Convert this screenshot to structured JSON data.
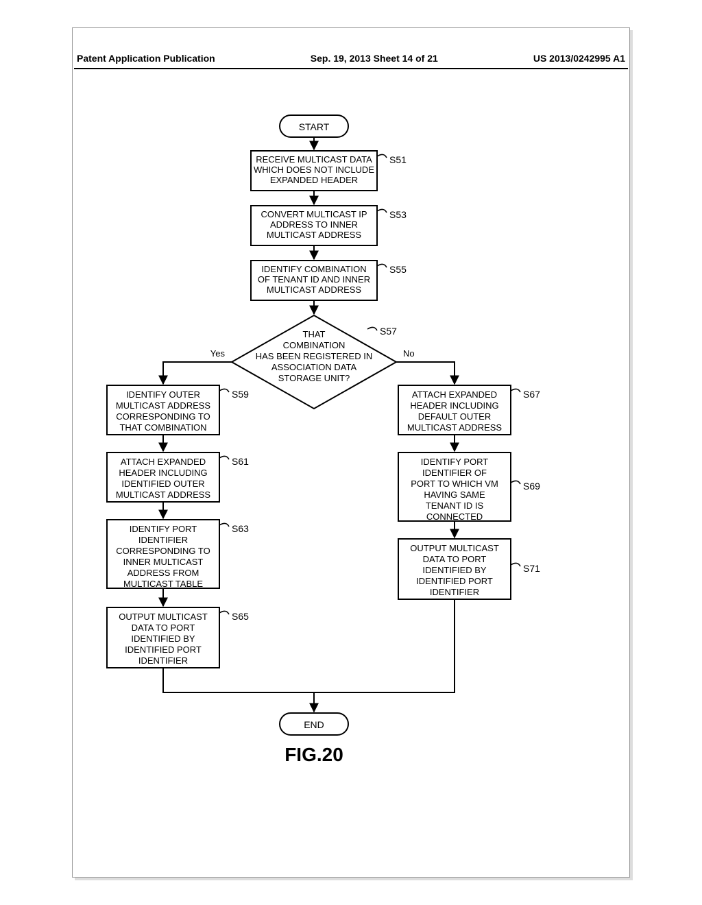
{
  "header": {
    "left": "Patent Application Publication",
    "center": "Sep. 19, 2013  Sheet 14 of 21",
    "right": "US 2013/0242995 A1"
  },
  "terminals": {
    "start": "START",
    "end": "END"
  },
  "edges": {
    "yes": "Yes",
    "no": "No"
  },
  "steps": {
    "s51": {
      "label": "S51",
      "lines": [
        "RECEIVE MULTICAST DATA",
        "WHICH DOES NOT INCLUDE",
        "EXPANDED HEADER"
      ]
    },
    "s53": {
      "label": "S53",
      "lines": [
        "CONVERT MULTICAST IP",
        "ADDRESS TO INNER",
        "MULTICAST ADDRESS"
      ]
    },
    "s55": {
      "label": "S55",
      "lines": [
        "IDENTIFY COMBINATION",
        "OF TENANT ID AND INNER",
        "MULTICAST ADDRESS"
      ]
    },
    "s57": {
      "label": "S57",
      "lines": [
        "THAT",
        "COMBINATION",
        "HAS BEEN REGISTERED IN",
        "ASSOCIATION DATA",
        "STORAGE UNIT?"
      ]
    },
    "s59": {
      "label": "S59",
      "lines": [
        "IDENTIFY OUTER",
        "MULTICAST ADDRESS",
        "CORRESPONDING TO",
        "THAT COMBINATION"
      ]
    },
    "s61": {
      "label": "S61",
      "lines": [
        "ATTACH EXPANDED",
        "HEADER INCLUDING",
        "IDENTIFIED OUTER",
        "MULTICAST ADDRESS"
      ]
    },
    "s63": {
      "label": "S63",
      "lines": [
        "IDENTIFY PORT",
        "IDENTIFIER",
        "CORRESPONDING TO",
        "INNER MULTICAST",
        "ADDRESS FROM",
        "MULTICAST TABLE"
      ]
    },
    "s65": {
      "label": "S65",
      "lines": [
        "OUTPUT MULTICAST",
        "DATA TO PORT",
        "IDENTIFIED BY",
        "IDENTIFIED PORT",
        "IDENTIFIER"
      ]
    },
    "s67": {
      "label": "S67",
      "lines": [
        "ATTACH EXPANDED",
        "HEADER INCLUDING",
        "DEFAULT OUTER",
        "MULTICAST ADDRESS"
      ]
    },
    "s69": {
      "label": "S69",
      "lines": [
        "IDENTIFY PORT",
        "IDENTIFIER OF",
        "PORT TO WHICH VM",
        "HAVING SAME",
        "TENANT ID IS",
        "CONNECTED"
      ]
    },
    "s71": {
      "label": "S71",
      "lines": [
        "OUTPUT MULTICAST",
        "DATA TO PORT",
        "IDENTIFIED BY",
        "IDENTIFIED PORT",
        "IDENTIFIER"
      ]
    }
  },
  "figure_caption": "FIG.20",
  "chart_data": {
    "type": "flowchart",
    "title": "FIG.20",
    "nodes": [
      {
        "id": "start",
        "kind": "terminal",
        "text": "START"
      },
      {
        "id": "s51",
        "kind": "process",
        "label": "S51",
        "text": "RECEIVE MULTICAST DATA WHICH DOES NOT INCLUDE EXPANDED HEADER"
      },
      {
        "id": "s53",
        "kind": "process",
        "label": "S53",
        "text": "CONVERT MULTICAST IP ADDRESS TO INNER MULTICAST ADDRESS"
      },
      {
        "id": "s55",
        "kind": "process",
        "label": "S55",
        "text": "IDENTIFY COMBINATION OF TENANT ID AND INNER MULTICAST ADDRESS"
      },
      {
        "id": "s57",
        "kind": "decision",
        "label": "S57",
        "text": "THAT COMBINATION HAS BEEN REGISTERED IN ASSOCIATION DATA STORAGE UNIT?"
      },
      {
        "id": "s59",
        "kind": "process",
        "label": "S59",
        "text": "IDENTIFY OUTER MULTICAST ADDRESS CORRESPONDING TO THAT COMBINATION"
      },
      {
        "id": "s61",
        "kind": "process",
        "label": "S61",
        "text": "ATTACH EXPANDED HEADER INCLUDING IDENTIFIED OUTER MULTICAST ADDRESS"
      },
      {
        "id": "s63",
        "kind": "process",
        "label": "S63",
        "text": "IDENTIFY PORT IDENTIFIER CORRESPONDING TO INNER MULTICAST ADDRESS FROM MULTICAST TABLE"
      },
      {
        "id": "s65",
        "kind": "process",
        "label": "S65",
        "text": "OUTPUT MULTICAST DATA TO PORT IDENTIFIED BY IDENTIFIED PORT IDENTIFIER"
      },
      {
        "id": "s67",
        "kind": "process",
        "label": "S67",
        "text": "ATTACH EXPANDED HEADER INCLUDING DEFAULT OUTER MULTICAST ADDRESS"
      },
      {
        "id": "s69",
        "kind": "process",
        "label": "S69",
        "text": "IDENTIFY PORT IDENTIFIER OF PORT TO WHICH VM HAVING SAME TENANT ID IS CONNECTED"
      },
      {
        "id": "s71",
        "kind": "process",
        "label": "S71",
        "text": "OUTPUT MULTICAST DATA TO PORT IDENTIFIED BY IDENTIFIED PORT IDENTIFIER"
      },
      {
        "id": "end",
        "kind": "terminal",
        "text": "END"
      }
    ],
    "edges": [
      {
        "from": "start",
        "to": "s51"
      },
      {
        "from": "s51",
        "to": "s53"
      },
      {
        "from": "s53",
        "to": "s55"
      },
      {
        "from": "s55",
        "to": "s57"
      },
      {
        "from": "s57",
        "to": "s59",
        "label": "Yes"
      },
      {
        "from": "s57",
        "to": "s67",
        "label": "No"
      },
      {
        "from": "s59",
        "to": "s61"
      },
      {
        "from": "s61",
        "to": "s63"
      },
      {
        "from": "s63",
        "to": "s65"
      },
      {
        "from": "s65",
        "to": "end"
      },
      {
        "from": "s67",
        "to": "s69"
      },
      {
        "from": "s69",
        "to": "s71"
      },
      {
        "from": "s71",
        "to": "end"
      }
    ]
  }
}
